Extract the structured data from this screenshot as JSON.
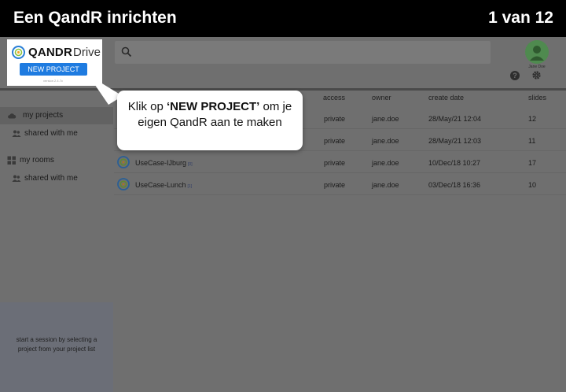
{
  "tutorial": {
    "title": "Een QandR inrichten",
    "step": "1 van 12"
  },
  "logo": {
    "brand": "QANDR",
    "product": "Drive",
    "version": "version 2.4.7c"
  },
  "toolbar": {
    "new_project_label": "NEW PROJECT"
  },
  "user": {
    "name": "Jane Doe"
  },
  "sidebar": {
    "items": [
      {
        "label": "my projects",
        "icon": "cloud-icon",
        "active": true
      },
      {
        "label": "shared with me",
        "icon": "users-icon",
        "active": false
      },
      {
        "label": "my rooms",
        "icon": "grid-icon",
        "active": false
      },
      {
        "label": "shared with me",
        "icon": "users-icon",
        "active": false
      }
    ],
    "session_hint": "start a session by selecting a project from your project list"
  },
  "table": {
    "columns": [
      "access",
      "owner",
      "create date",
      "slides"
    ],
    "rows": [
      {
        "name": "",
        "count": "",
        "access": "private",
        "owner": "jane.doe",
        "date": "28/May/21 12:04",
        "slides": "12"
      },
      {
        "name": "",
        "count": "",
        "access": "private",
        "owner": "jane.doe",
        "date": "28/May/21 12:03",
        "slides": "11"
      },
      {
        "name": "UseCase-IJburg",
        "count": "[0]",
        "access": "private",
        "owner": "jane.doe",
        "date": "10/Dec/18 10:27",
        "slides": "17"
      },
      {
        "name": "UseCase-Lunch",
        "count": "[1]",
        "access": "private",
        "owner": "jane.doe",
        "date": "03/Dec/18 16:36",
        "slides": "10"
      }
    ]
  },
  "callout": {
    "prefix": "Klik op ",
    "highlight": "‘NEW PROJECT’",
    "suffix": " om je eigen QandR aan te maken"
  },
  "colors": {
    "tutorial_bar": "#000000",
    "overlay": "#6f6f6f",
    "accent_button": "#1e7be0",
    "callout_bg": "#ffffff"
  }
}
